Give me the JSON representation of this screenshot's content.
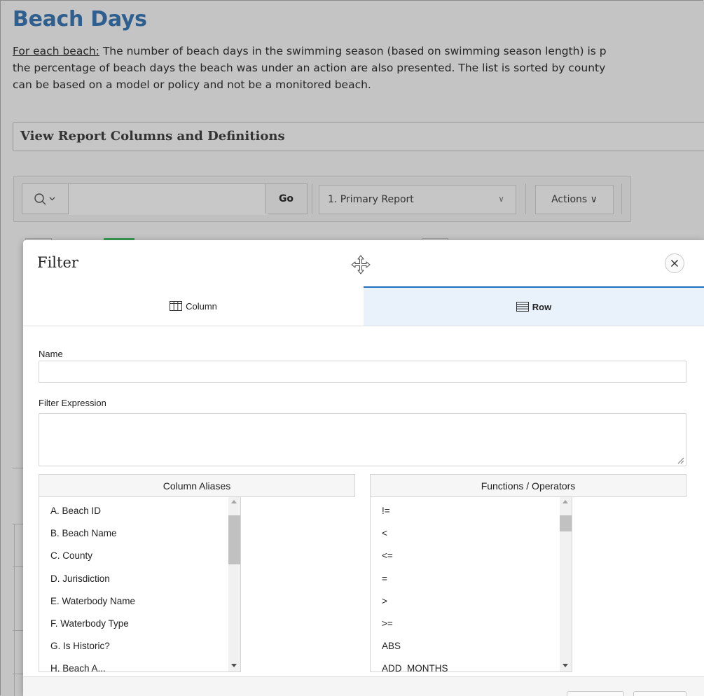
{
  "page": {
    "title": "Beach Days",
    "intro_prefix": "For each beach:",
    "intro_line1_rest": " The number of beach days in the swimming season (based on swimming season length) is p",
    "intro_line2": "the percentage of beach days the beach was under an action are also presented. The list is sorted by county",
    "intro_line3": "can be based on a model or policy and not be a monitored beach.",
    "collapsible_label": "View Report Columns and Definitions"
  },
  "toolbar": {
    "search_icon": "search-icon",
    "search_value": "",
    "go_label": "Go",
    "report_selected": "1. Primary Report",
    "actions_label": "Actions ∨"
  },
  "dialog": {
    "title": "Filter",
    "drag_icon": "move-icon",
    "close_icon": "close-icon",
    "tabs": [
      {
        "label": "Column",
        "icon": "table-columns-icon",
        "selected": false
      },
      {
        "label": "Row",
        "icon": "table-rows-icon",
        "selected": true
      }
    ],
    "name_label": "Name",
    "name_value": "",
    "expression_label": "Filter Expression",
    "expression_value": "",
    "column_aliases": {
      "header": "Column Aliases",
      "items": [
        "A. Beach ID",
        "B. Beach Name",
        "C. County",
        "D. Jurisdiction",
        "E. Waterbody Name",
        "F. Waterbody Type",
        "G. Is Historic?",
        "H. Beach A..."
      ]
    },
    "functions": {
      "header": "Functions / Operators",
      "items": [
        "!=",
        "<",
        "<=",
        "=",
        ">",
        ">=",
        "ABS",
        "ADD_MONTHS"
      ]
    }
  },
  "colors": {
    "title_blue": "#2e5f8f",
    "tab_accent": "#1f6fbf",
    "overlay_gray": "#c4c4c4"
  }
}
